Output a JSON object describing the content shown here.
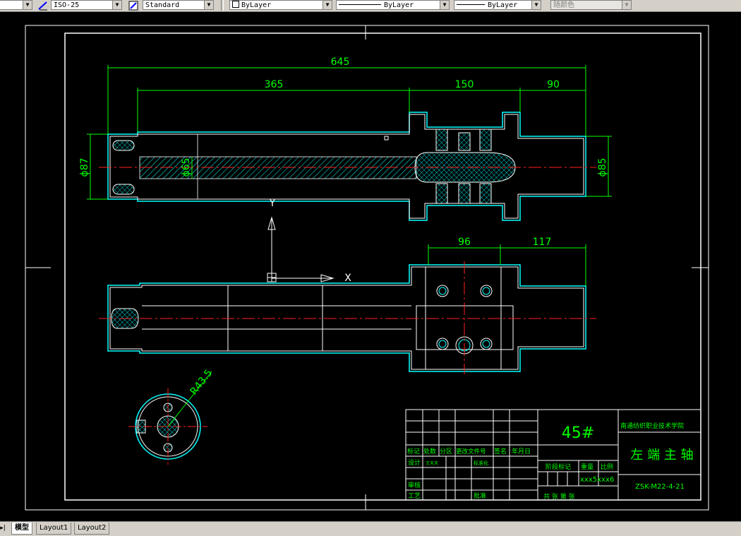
{
  "toolbar": {
    "dimstyle": "ISO-25",
    "textstyle": "Standard",
    "layer": "ByLayer",
    "linetype": "ByLayer",
    "lineweight": "ByLayer",
    "plotstyle": "随颜色"
  },
  "dims": {
    "overall": "645",
    "d365": "365",
    "d150": "150",
    "d90": "90",
    "dia87": "ϕ87",
    "dia65": "ϕ65",
    "dia85": "ϕ85",
    "d96": "96",
    "d117": "117",
    "radius": "R43.5"
  },
  "ucs": {
    "y": "Y",
    "x": "X"
  },
  "title_block": {
    "material": "45#",
    "school": "南通纺织职业技术学院",
    "part_name": "左 端 主 轴",
    "drawing_no": "ZSK-M22-4-21",
    "scale_values": "xxx5xxx6",
    "rev_headers": [
      "标记",
      "处数",
      "分区",
      "更改文件号",
      "签名",
      "年月日"
    ],
    "design": "设计",
    "design_extra": "王天天",
    "standardize": "标准化",
    "stage_mark": "阶段标记",
    "weight": "重量",
    "scale": "比例",
    "review": "审核",
    "process": "工艺",
    "approve": "批准",
    "sheets": "共  张 第  张"
  },
  "tabs": [
    "模型",
    "Layout1",
    "Layout2"
  ],
  "nav_glyph": "▸|"
}
